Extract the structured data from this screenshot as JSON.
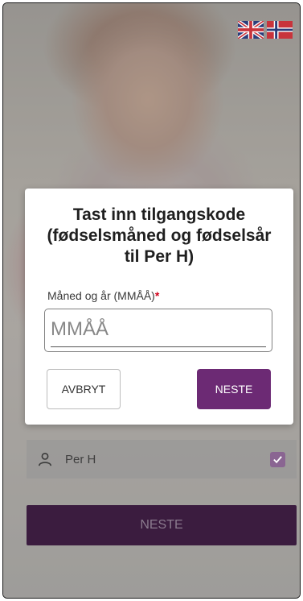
{
  "language_flags": [
    {
      "name": "uk-flag-icon",
      "language": "English"
    },
    {
      "name": "norway-flag-icon",
      "language": "Norsk"
    }
  ],
  "dialog": {
    "title_line1": "Tast inn tilgangskode",
    "title_line2": "(fødselsmåned og fødselsår",
    "title_line3": "til Per H)",
    "field_label": "Måned og år (MMÅÅ)",
    "required_marker": "*",
    "input_placeholder": "MMÅÅ",
    "input_value": "",
    "cancel_label": "AVBRYT",
    "next_label": "NESTE"
  },
  "user_list": {
    "items": [
      {
        "name": "Per H",
        "checked": true
      }
    ]
  },
  "footer": {
    "next_label": "NESTE"
  },
  "colors": {
    "accent": "#6c2a74",
    "accent_dark": "#3b1c3f",
    "required": "#d0021b"
  }
}
